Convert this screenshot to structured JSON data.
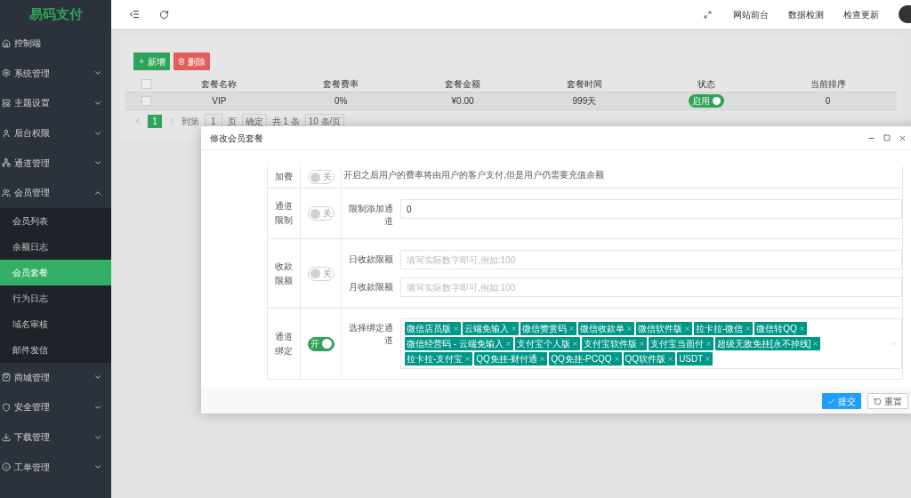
{
  "sidebar": {
    "logo": "易码支付",
    "items": [
      {
        "label": "控制端",
        "selected": false
      },
      {
        "label": "系统管理",
        "expanded": false,
        "selected": false
      },
      {
        "label": "主题设置",
        "expanded": false,
        "selected": false
      },
      {
        "label": "后台权限",
        "expanded": false,
        "selected": false
      },
      {
        "label": "通道管理",
        "expanded": false,
        "selected": false
      },
      {
        "label": "会员管理",
        "expanded": true,
        "selected": false,
        "children": [
          {
            "label": "会员列表",
            "selected": false
          },
          {
            "label": "余额日志",
            "selected": false
          },
          {
            "label": "会员套餐",
            "selected": true
          },
          {
            "label": "行为日志",
            "selected": false
          },
          {
            "label": "域名审核",
            "selected": false
          },
          {
            "label": "邮件发信",
            "selected": false
          }
        ]
      },
      {
        "label": "商城管理",
        "expanded": false,
        "selected": false
      },
      {
        "label": "安全管理",
        "expanded": false,
        "selected": false
      },
      {
        "label": "下载管理",
        "expanded": false,
        "selected": false
      },
      {
        "label": "工单管理",
        "expanded": false,
        "selected": false
      }
    ]
  },
  "header": {
    "links": [
      "网站前台",
      "数据检测",
      "检查更新"
    ]
  },
  "toolbar": [
    {
      "label": "新增",
      "kind": "add"
    },
    {
      "label": "删除",
      "kind": "delete"
    }
  ],
  "table": {
    "header_checked": false,
    "columns": [
      "套餐名称",
      "套餐费率",
      "套餐金额",
      "套餐时间",
      "状态",
      "当前排序"
    ],
    "rows": [
      {
        "checked": false,
        "cells": [
          "VIP",
          "0%",
          "¥0.00",
          "999天"
        ],
        "status": {
          "label": "启用",
          "on": true
        },
        "sort": "0"
      }
    ]
  },
  "pagination": {
    "pages": [
      {
        "label": "1",
        "selected": true
      }
    ],
    "goto_label": "到第",
    "goto_value": "1",
    "page_unit": "页",
    "confirm": "确定",
    "total": "共 1 条",
    "page_size": "10 条/页"
  },
  "modal": {
    "title": "修改会员套餐",
    "rows": [
      {
        "kind": "note",
        "label": "加费",
        "switch": {
          "label": "关",
          "on": false
        },
        "note": "开启之后用户的费率将由用户的客户支付,但是用户仍需要充值余额"
      },
      {
        "kind": "fields",
        "label": "通道限制",
        "switch": {
          "label": "关",
          "on": false
        },
        "fields": [
          {
            "label": "限制添加通道",
            "value": "0"
          }
        ]
      },
      {
        "kind": "fields",
        "label": "收款限额",
        "switch": {
          "label": "关",
          "on": false
        },
        "fields": [
          {
            "label": "日收款限额",
            "placeholder": "填写实际数字即可,例如:100"
          },
          {
            "label": "月收款限额",
            "placeholder": "填写实际数字即可,例如:100"
          }
        ]
      },
      {
        "kind": "tags",
        "label": "通道绑定",
        "switch": {
          "label": "开",
          "on": true
        },
        "field_label": "选择绑定通道",
        "tags": [
          "微信店员版",
          "云端免输入",
          "微信赞赏码",
          "微信收款单",
          "微信软件版",
          "拉卡拉-微信",
          "微信转QQ",
          "微信经营码 - 云端免输入",
          "支付宝个人版",
          "支付宝软件版",
          "支付宝当面付",
          "超级无敌免挂[永不掉线]",
          "拉卡拉-支付宝",
          "QQ免挂-财付通",
          "QQ免挂-PCQQ",
          "QQ软件版",
          "USDT"
        ]
      }
    ],
    "buttons": [
      {
        "label": "提交",
        "kind": "submit"
      },
      {
        "label": "重置",
        "kind": "reset"
      }
    ]
  }
}
